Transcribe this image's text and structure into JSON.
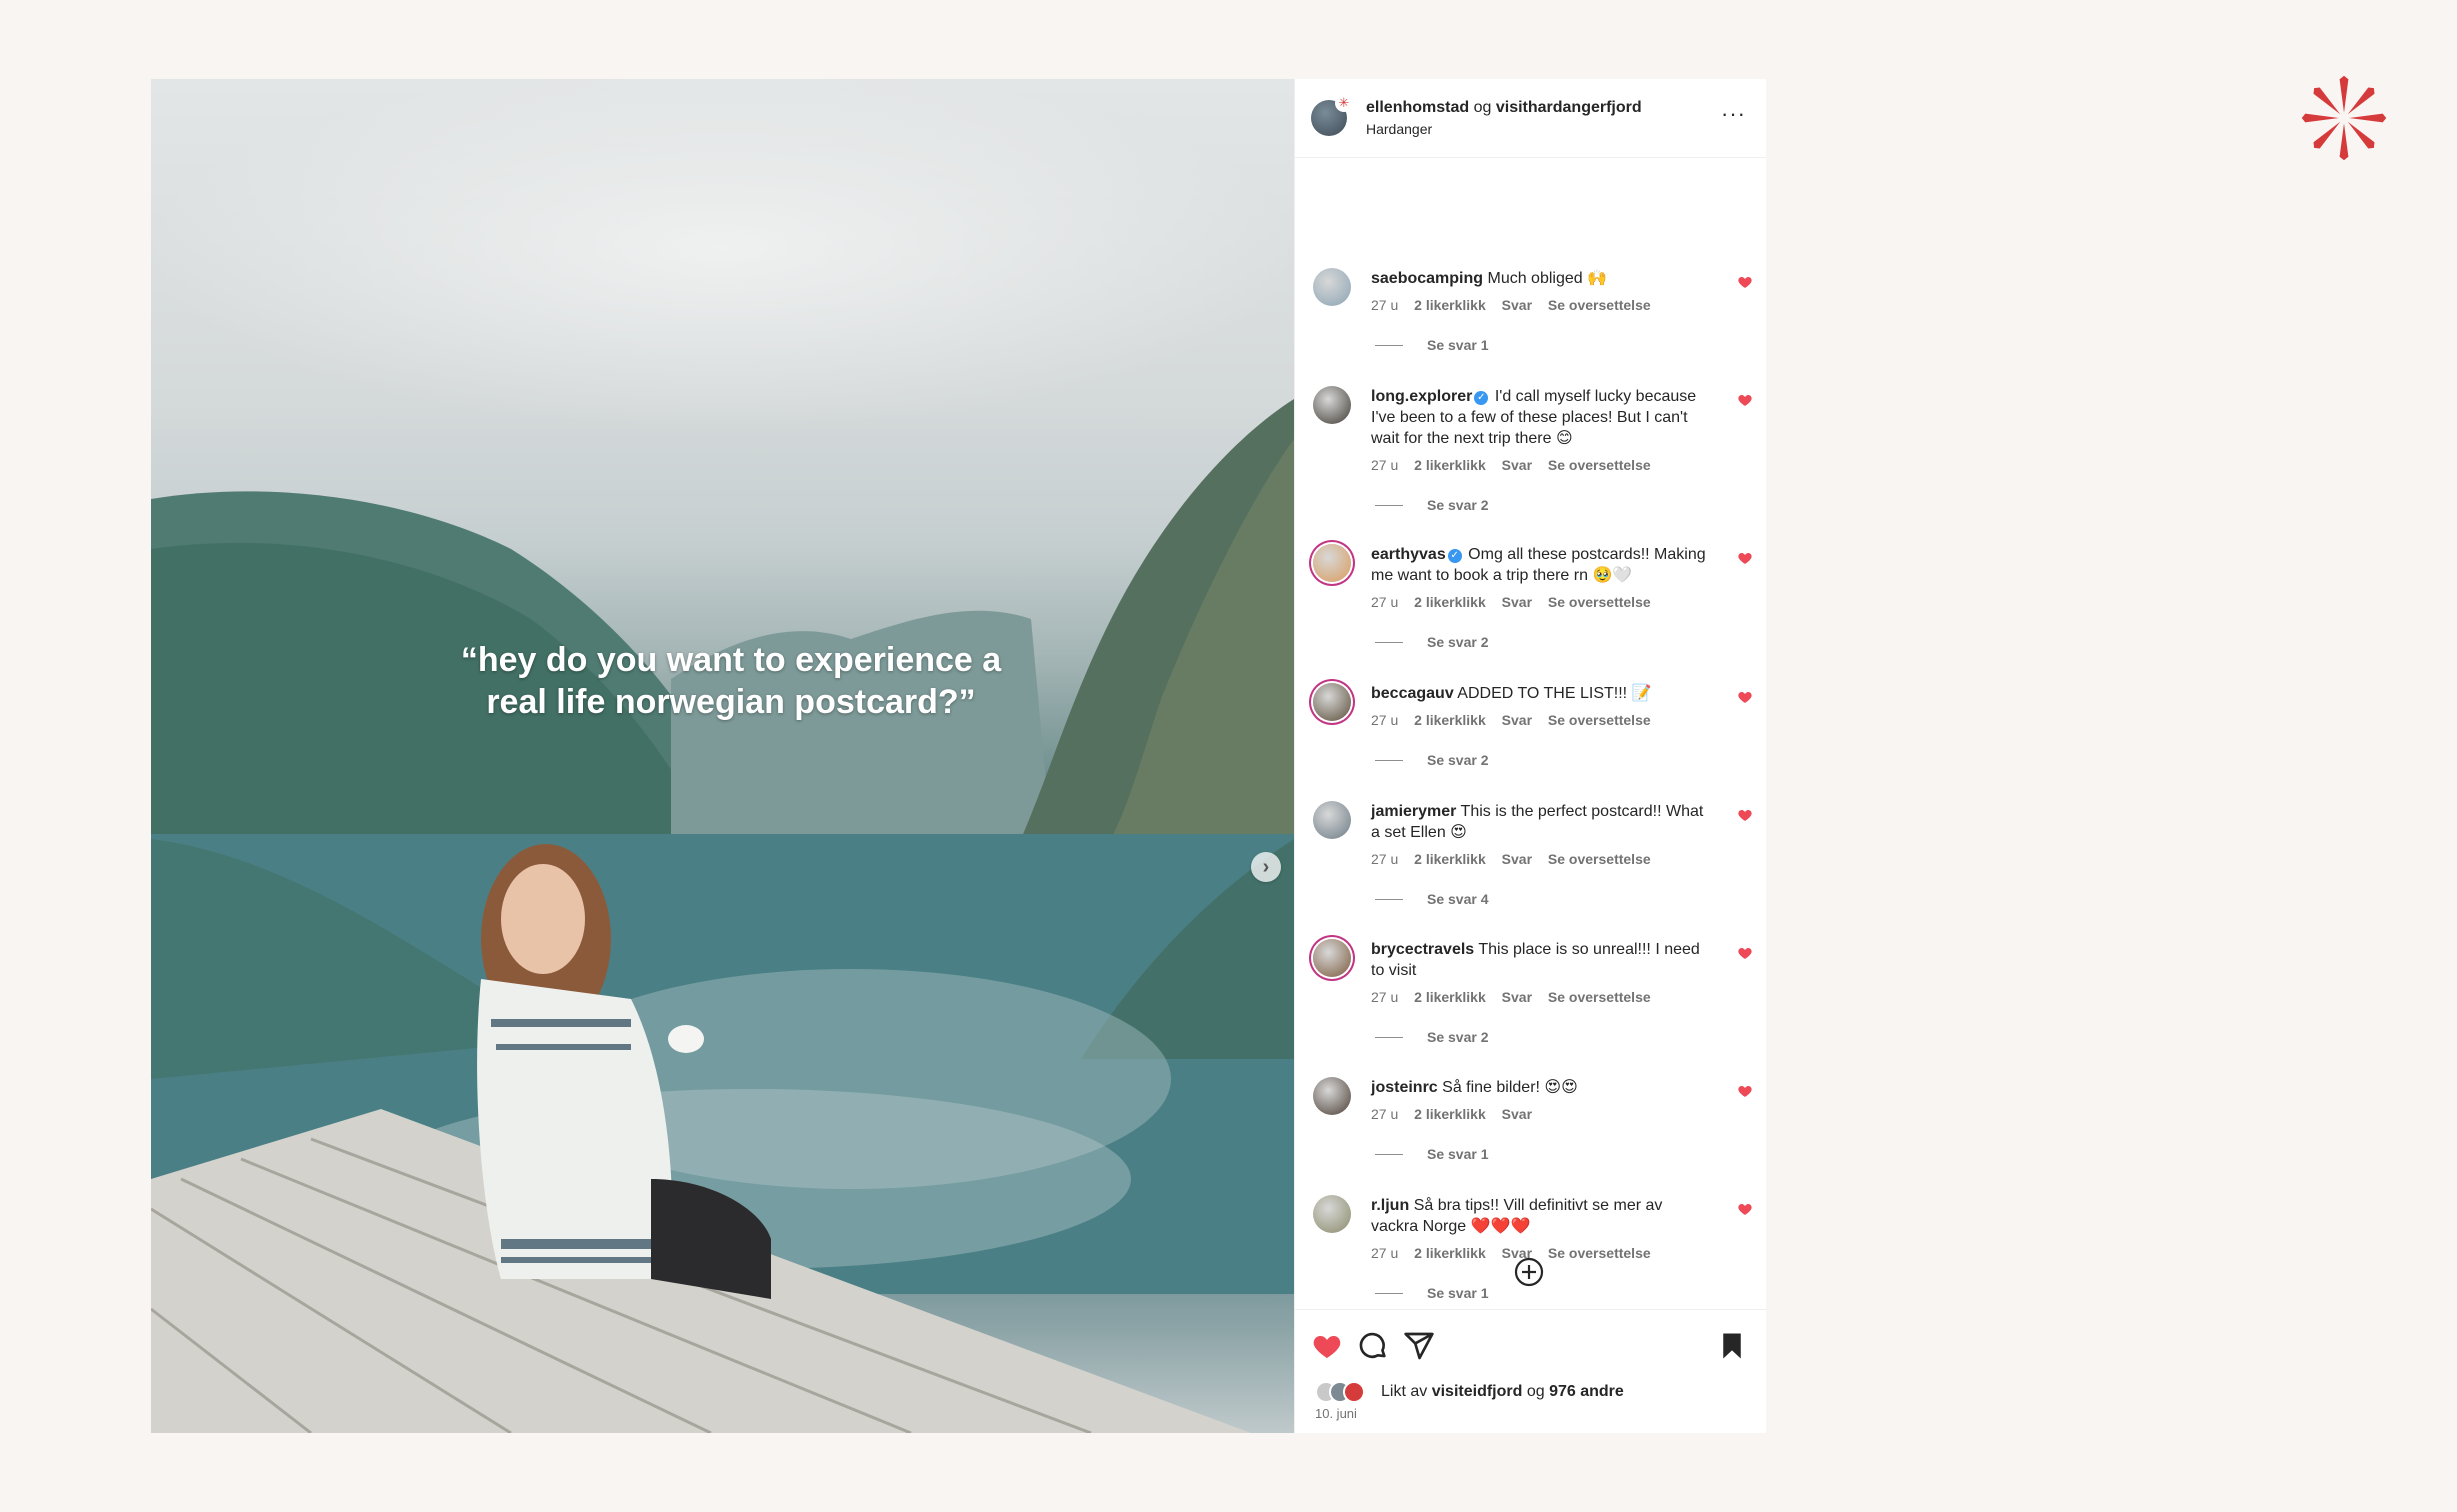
{
  "post": {
    "author": "ellenhomstad",
    "joiner": "og",
    "collaborator": "visithardangerfjord",
    "location": "Hardanger",
    "more_label": "···",
    "image_quote_line1": "“hey do you want to experience a",
    "image_quote_line2": "real life norwegian postcard?”",
    "next_label": "›"
  },
  "comments": [
    {
      "user": "saebocamping",
      "verified": false,
      "text": "Much obliged 🙌",
      "time": "27 u",
      "likes": "2 likerklikk",
      "reply": "Svar",
      "translate": "Se oversettelse",
      "replies": "Se svar 1"
    },
    {
      "user": "long.explorer",
      "verified": true,
      "text": "I'd call myself lucky because I've been to a few of these places! But I can't wait for the next trip there 😊",
      "time": "27 u",
      "likes": "2 likerklikk",
      "reply": "Svar",
      "translate": "Se oversettelse",
      "replies": "Se svar 2"
    },
    {
      "user": "earthyvas",
      "verified": true,
      "text": "Omg all these postcards!! Making me want to book a trip there rn 🥹🤍",
      "time": "27 u",
      "likes": "2 likerklikk",
      "reply": "Svar",
      "translate": "Se oversettelse",
      "replies": "Se svar 2"
    },
    {
      "user": "beccagauv",
      "verified": false,
      "text": "ADDED TO THE LIST!!! 📝",
      "time": "27 u",
      "likes": "2 likerklikk",
      "reply": "Svar",
      "translate": "Se oversettelse",
      "replies": "Se svar 2"
    },
    {
      "user": "jamierymer",
      "verified": false,
      "text": "This is the perfect postcard!! What a set Ellen 😍",
      "time": "27 u",
      "likes": "2 likerklikk",
      "reply": "Svar",
      "translate": "Se oversettelse",
      "replies": "Se svar 4"
    },
    {
      "user": "brycectravels",
      "verified": false,
      "text": "This place is so unreal!!! I need to visit",
      "time": "27 u",
      "likes": "2 likerklikk",
      "reply": "Svar",
      "translate": "Se oversettelse",
      "replies": "Se svar 2"
    },
    {
      "user": "josteinrc",
      "verified": false,
      "text": "Så fine bilder! 😍😍",
      "time": "27 u",
      "likes": "2 likerklikk",
      "reply": "Svar",
      "translate": "",
      "replies": "Se svar 1"
    },
    {
      "user": "r.ljun",
      "verified": false,
      "text": "Så bra tips!! Vill definitivt se mer av vackra Norge ❤️❤️❤️",
      "time": "27 u",
      "likes": "2 likerklikk",
      "reply": "Svar",
      "translate": "Se oversettelse",
      "replies": "Se svar 1"
    }
  ],
  "footer": {
    "liked_prefix": "Likt av",
    "liked_user": "visiteidfjord",
    "liked_joiner": "og",
    "liked_others": "976 andre",
    "date": "10. juni"
  },
  "colors": {
    "heart": "#ed4956",
    "brand": "#d63b3b",
    "page_bg": "#f8f5f3"
  },
  "icons": [
    "brand-star-icon",
    "more-icon",
    "chevron-right-icon",
    "heart-icon",
    "comment-icon",
    "share-icon",
    "bookmark-icon",
    "add-circle-icon"
  ]
}
